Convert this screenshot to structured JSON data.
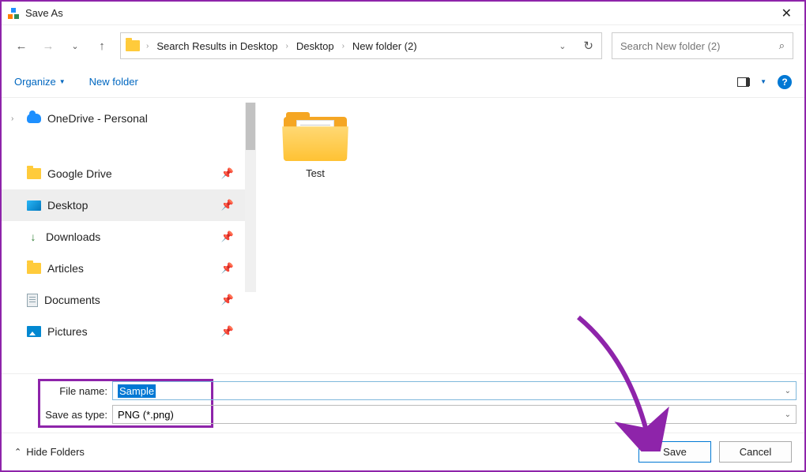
{
  "window": {
    "title": "Save As"
  },
  "breadcrumb": {
    "items": [
      "Search Results in Desktop",
      "Desktop",
      "New folder (2)"
    ]
  },
  "search": {
    "placeholder": "Search New folder (2)"
  },
  "commands": {
    "organize": "Organize",
    "new_folder": "New folder"
  },
  "tree": {
    "onedrive": "OneDrive - Personal",
    "gdrive": "Google Drive",
    "desktop": "Desktop",
    "downloads": "Downloads",
    "articles": "Articles",
    "documents": "Documents",
    "pictures": "Pictures"
  },
  "content": {
    "items": [
      {
        "name": "Test"
      }
    ]
  },
  "fields": {
    "filename_label": "File name:",
    "filename_value": "Sample",
    "type_label": "Save as type:",
    "type_value": "PNG (*.png)"
  },
  "footer": {
    "hide": "Hide Folders",
    "save": "Save",
    "cancel": "Cancel"
  }
}
